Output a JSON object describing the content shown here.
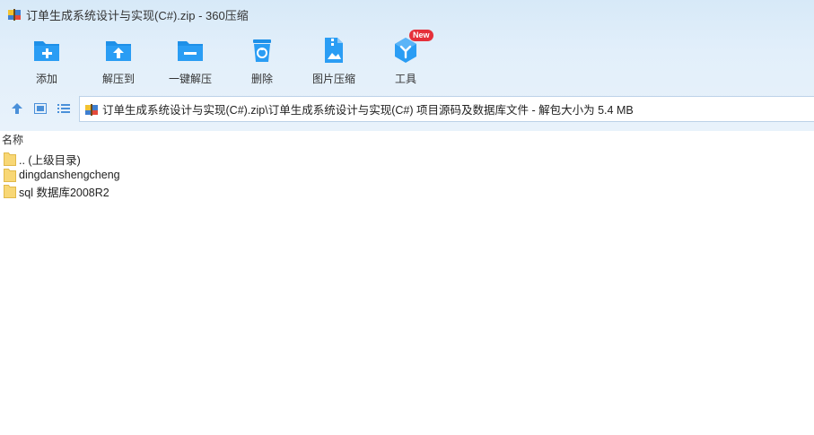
{
  "window": {
    "title": "订单生成系统设计与实现(C#).zip - 360压缩"
  },
  "toolbar": {
    "items": [
      {
        "label": "添加",
        "icon": "add-icon"
      },
      {
        "label": "解压到",
        "icon": "extract-to-icon"
      },
      {
        "label": "一键解压",
        "icon": "one-click-extract-icon"
      },
      {
        "label": "删除",
        "icon": "delete-icon"
      },
      {
        "label": "图片压缩",
        "icon": "image-compress-icon"
      },
      {
        "label": "工具",
        "icon": "tools-icon",
        "badge": "New"
      }
    ]
  },
  "nav": {
    "address": "订单生成系统设计与实现(C#).zip\\订单生成系统设计与实现(C#) 项目源码及数据库文件 - 解包大小为 5.4 MB"
  },
  "file_list": {
    "column_header": "名称",
    "rows": [
      {
        "name": ".. (上级目录)"
      },
      {
        "name": "dingdanshengcheng"
      },
      {
        "name": "sql 数据库2008R2"
      }
    ]
  },
  "colors": {
    "accent": "#1e90e8",
    "folder": "#f8d775",
    "badge": "#e5303a"
  }
}
